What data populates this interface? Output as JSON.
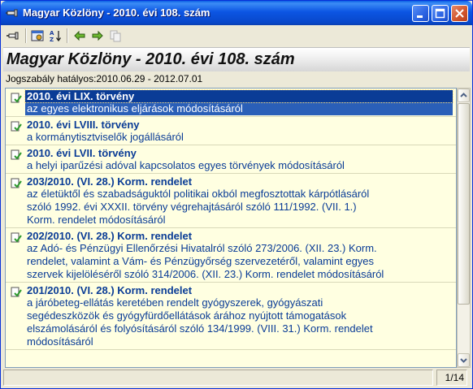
{
  "window": {
    "title": "Magyar Közlöny - 2010. évi 108. szám",
    "icon": "pin-icon"
  },
  "toolbar": {
    "buttons": [
      "pin-icon",
      "show-hide-icon",
      "sort-az-icon",
      "back-arrow-icon",
      "forward-arrow-icon",
      "copy-icon"
    ]
  },
  "header": {
    "title": "Magyar Közlöny - 2010. évi 108. szám",
    "validity": "Jogszabály hatályos:2010.06.29 - 2012.07.01"
  },
  "items": [
    {
      "title": "2010. évi LIX. törvény",
      "lines": [
        "az egyes elektronikus eljárások módosításáról"
      ],
      "selected": true
    },
    {
      "title": "2010. évi LVIII. törvény",
      "lines": [
        "a kormánytisztviselők jogállásáról"
      ]
    },
    {
      "title": "2010. évi LVII. törvény",
      "lines": [
        "a helyi iparűzési adóval kapcsolatos egyes törvények módosításáról"
      ]
    },
    {
      "title": "203/2010. (VI. 28.) Korm. rendelet",
      "lines": [
        "az életüktől és szabadságuktól politikai okból megfosztottak kárpótlásáról",
        "szóló 1992. évi XXXII. törvény végrehajtásáról szóló 111/1992. (VII. 1.)",
        "Korm. rendelet módosításáról"
      ]
    },
    {
      "title": "202/2010. (VI. 28.) Korm. rendelet",
      "lines": [
        "az Adó- és Pénzügyi Ellenőrzési Hivatalról szóló 273/2006. (XII. 23.) Korm.",
        "rendelet, valamint a Vám- és Pénzügyőrség szervezetéről, valamint egyes",
        "szervek kijelöléséről szóló 314/2006. (XII. 23.) Korm. rendelet módosításáról"
      ]
    },
    {
      "title": "201/2010. (VI. 28.) Korm. rendelet",
      "lines": [
        "a járóbeteg-ellátás keretében rendelt gyógyszerek, gyógyászati",
        "segédeszközök és gyógyfürdőellátások árához nyújtott támogatások",
        "elszámolásáról és folyósításáról szóló 134/1999. (VIII. 31.) Korm. rendelet",
        "módosításáról"
      ]
    }
  ],
  "status": {
    "page": "1/14"
  },
  "colors": {
    "titlebar": "#0A4FD6",
    "list_bg": "#FFFFE1",
    "link_text": "#0A3C96",
    "selected_bg": "#0A3C96"
  }
}
